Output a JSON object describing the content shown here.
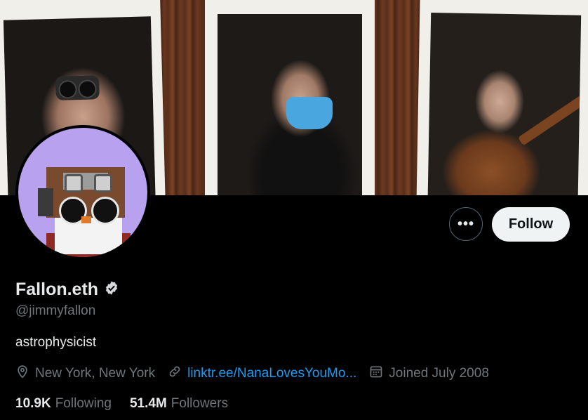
{
  "profile": {
    "display_name": "Fallon.eth",
    "verified": true,
    "handle": "@jimmyfallon",
    "bio": "astrophysicist",
    "location": "New York, New York",
    "website": "linktr.ee/NanaLovesYouMo...",
    "joined": "Joined July 2008"
  },
  "stats": {
    "following_count": "10.9K",
    "following_label": "Following",
    "followers_count": "51.4M",
    "followers_label": "Followers"
  },
  "actions": {
    "more_label": "•••",
    "follow_label": "Follow"
  },
  "icons": {
    "verified": "verified-badge-icon",
    "location": "location-pin-icon",
    "link": "link-icon",
    "calendar": "calendar-icon",
    "more": "more-dots-icon"
  },
  "colors": {
    "background": "#000000",
    "text_primary": "#e7e9ea",
    "text_secondary": "#71767b",
    "link": "#1d9bf0",
    "follow_button_bg": "#eff3f4",
    "avatar_bg": "#b8a2ef"
  }
}
